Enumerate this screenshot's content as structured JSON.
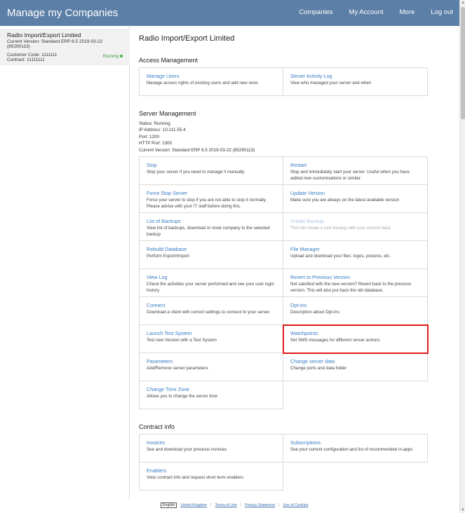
{
  "header": {
    "brand": "Manage my Companies",
    "nav": [
      "Companies",
      "My Account",
      "More",
      "Log out"
    ]
  },
  "sidebar": {
    "company_name": "Radio Import/Export Limited",
    "version": "Current Version: Standard ERP 8.5 2019-03-22 (85290113)",
    "customer_code": "Customer Code: 1111111",
    "contract": "Contract: 11111111",
    "status": "Running"
  },
  "main": {
    "title": "Radio Import/Export Limited",
    "access_title": "Access Management",
    "access": [
      {
        "title": "Manage Users",
        "desc": "Manage access rights of existing users and add new ones"
      },
      {
        "title": "Server Activity Log",
        "desc": "View who managed your server and when"
      }
    ],
    "server_title": "Server Management",
    "server_info": {
      "status": "Status: Running",
      "ip": "IP Address: 10.211.55.4",
      "port": "Port: 1200",
      "http_port": "HTTP Port: 1300",
      "version": "Current Version: Standard ERP 8.5 2019-03-22 (85290113)"
    },
    "server": [
      {
        "title": "Stop",
        "desc": "Stop your server if you need to manage it manually"
      },
      {
        "title": "Restart",
        "desc": "Stop and immediately start your server. Useful when you have added new customisations or similar."
      },
      {
        "title": "Force Stop Server",
        "desc": "Force your server to stop if you are not able to stop it normally. Please advise with your IT staff before doing this."
      },
      {
        "title": "Update Version",
        "desc": "Make sure you are always on the latest available version"
      },
      {
        "title": "List of Backups",
        "desc": "View list of backups, download or reset company to the selected backup"
      },
      {
        "title": "Create Backup",
        "desc": "This will create a new backup with your current data."
      },
      {
        "title": "Rebuild Database",
        "desc": "Perform Export/Import"
      },
      {
        "title": "File Manager",
        "desc": "Upload and download your files: logos, pictures, etc."
      },
      {
        "title": "View Log",
        "desc": "Check the activities your server performed and see your user login history"
      },
      {
        "title": "Revert to Previous Version",
        "desc": "Not satisfied with the new version? Revert back to the previous version. This will also put back the old database."
      },
      {
        "title": "Connect",
        "desc": "Download a client with correct settings to connect to your server."
      },
      {
        "title": "Opt-ins",
        "desc": "Description about Opt-ins"
      },
      {
        "title": "Launch Test System",
        "desc": "Test new Version with a Test System"
      },
      {
        "title": "Watchpoints",
        "desc": "Set SMS messages for different server actions"
      },
      {
        "title": "Parameters",
        "desc": "Add/Remove server parameters"
      },
      {
        "title": "Change server data",
        "desc": "Change ports and data folder"
      },
      {
        "title": "Change Time Zone",
        "desc": "Allows you to change the server time"
      }
    ],
    "contract_title": "Contract info",
    "contract": [
      {
        "title": "Invoices",
        "desc": "See and download your previous invoices"
      },
      {
        "title": "Subscriptions",
        "desc": "See your current configuration and list of recommended in-apps"
      },
      {
        "title": "Enablers",
        "desc": "View contract info and request short term enablers"
      }
    ]
  },
  "footer": {
    "language": "English",
    "links": [
      "United Kingdom",
      "Terms of Use",
      "Privacy Statement",
      "Use of Cookies"
    ]
  },
  "colors": {
    "header_bg": "#5b7fa6",
    "link": "#3b7dc4",
    "highlight": "#e01b1b",
    "running": "#3a9b3a"
  }
}
